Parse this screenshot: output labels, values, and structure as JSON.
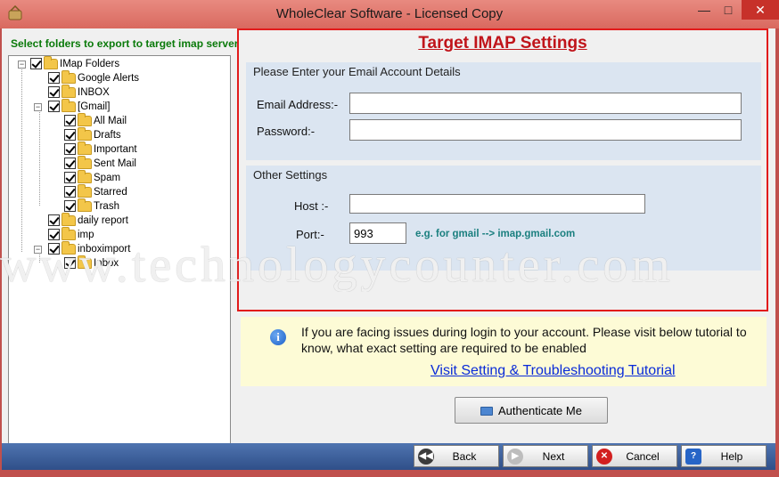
{
  "window": {
    "title": "WholeClear Software - Licensed Copy",
    "min_glyph": "—",
    "max_glyph": "□",
    "close_glyph": "✕"
  },
  "tree": {
    "caption": "Select folders to export to target imap server",
    "nodes": [
      {
        "label": "IMap Folders",
        "expander": "−"
      },
      {
        "label": "Google Alerts"
      },
      {
        "label": "INBOX"
      },
      {
        "label": "[Gmail]",
        "expander": "−"
      },
      {
        "label": "All Mail"
      },
      {
        "label": "Drafts"
      },
      {
        "label": "Important"
      },
      {
        "label": "Sent Mail"
      },
      {
        "label": "Spam"
      },
      {
        "label": "Starred"
      },
      {
        "label": "Trash"
      },
      {
        "label": "daily report"
      },
      {
        "label": "imp"
      },
      {
        "label": "inboximport",
        "expander": "−"
      },
      {
        "label": "Inbox"
      }
    ]
  },
  "target": {
    "title": "Target IMAP Settings",
    "account_group": {
      "title": "Please Enter your Email Account Details",
      "email_label": "Email Address:-",
      "email_value": "",
      "password_label": "Password:-",
      "password_value": ""
    },
    "other_group": {
      "title": "Other Settings",
      "host_label": "Host :-",
      "host_value": "",
      "port_label": "Port:-",
      "port_value": "993",
      "port_hint": "e.g. for gmail -->  imap.gmail.com"
    }
  },
  "watermark": "www.technologycounter.com",
  "info": {
    "icon": "info-icon",
    "text": "If you are facing issues during login to your account. Please visit below tutorial to know, what exact setting are required to be enabled",
    "link": "Visit Setting & Troubleshooting Tutorial"
  },
  "authenticate_label": "Authenticate Me",
  "nav": {
    "back": "Back",
    "next": "Next",
    "cancel": "Cancel",
    "help": "Help",
    "back_glyph": "◀◀",
    "next_glyph": "▶",
    "cancel_glyph": "✕",
    "help_glyph": "?"
  },
  "colors": {
    "title_bar": "#d9695f",
    "frame_border": "#e21b1b",
    "target_title": "#c0141a",
    "group_bg": "#dbe5f1",
    "info_bg": "#fdfbd6",
    "link": "#0a2bd8",
    "caption_green": "#0a7a0a",
    "bottom_bar": "#2f4f89"
  }
}
